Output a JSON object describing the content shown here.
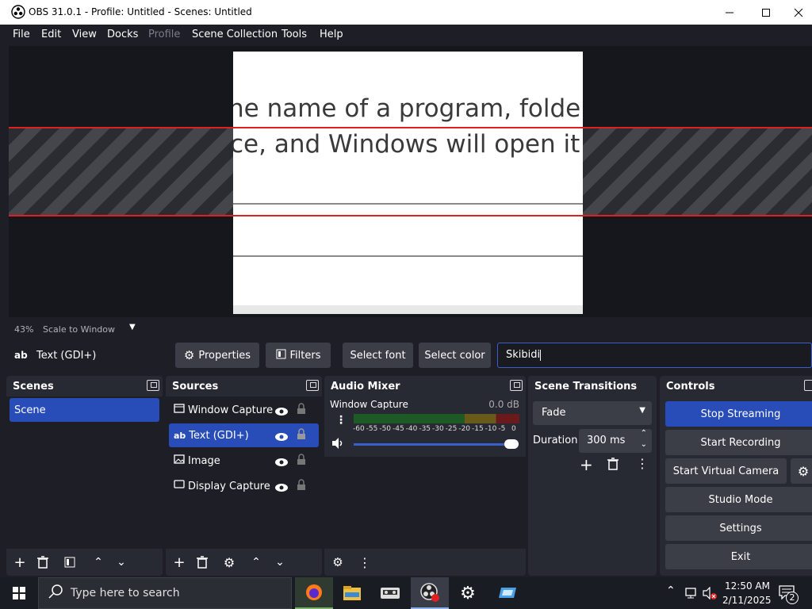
{
  "window": {
    "title": "OBS 31.0.1 - Profile: Untitled - Scenes: Untitled"
  },
  "menu": [
    "File",
    "Edit",
    "View",
    "Docks",
    "Profile",
    "Scene Collection",
    "Tools",
    "Help"
  ],
  "preview": {
    "line1": "he name of a program, folder",
    "line2": "ce, and Windows will open it"
  },
  "status": {
    "zoom": "43%",
    "scale_mode": "Scale to Window"
  },
  "source_toolbar": {
    "source_type_icon": "ab",
    "source_name": "Text (GDI+)",
    "properties": "Properties",
    "filters": "Filters",
    "select_font": "Select font",
    "select_color": "Select color",
    "text_value": "Skibidi"
  },
  "scenes": {
    "title": "Scenes",
    "items": [
      "Scene"
    ]
  },
  "sources": {
    "title": "Sources",
    "items": [
      {
        "label": "Window Capture",
        "icon": "window-icon"
      },
      {
        "label": "Text (GDI+)",
        "icon": "ab"
      },
      {
        "label": "Image",
        "icon": "image-icon"
      },
      {
        "label": "Display Capture",
        "icon": "monitor-icon"
      }
    ]
  },
  "mixer": {
    "title": "Audio Mixer",
    "channel": "Window Capture",
    "level": "0.0 dB",
    "ticks": [
      "-60",
      "-55",
      "-50",
      "-45",
      "-40",
      "-35",
      "-30",
      "-25",
      "-20",
      "-15",
      "-10",
      "-5",
      "0"
    ],
    "volume_fraction": 1.0
  },
  "transitions": {
    "title": "Scene Transitions",
    "selected": "Fade",
    "duration_label": "Duration",
    "duration_value": "300 ms"
  },
  "controls": {
    "title": "Controls",
    "stop_streaming": "Stop Streaming",
    "start_recording": "Start Recording",
    "start_virtual_camera": "Start Virtual Camera",
    "studio_mode": "Studio Mode",
    "settings": "Settings",
    "exit": "Exit"
  },
  "taskbar": {
    "search_placeholder": "Type here to search",
    "time": "12:50 AM",
    "date": "2/11/2025",
    "notification_count": "2"
  },
  "colors": {
    "accent": "#284cb8",
    "highlight_red": "#e02020"
  }
}
